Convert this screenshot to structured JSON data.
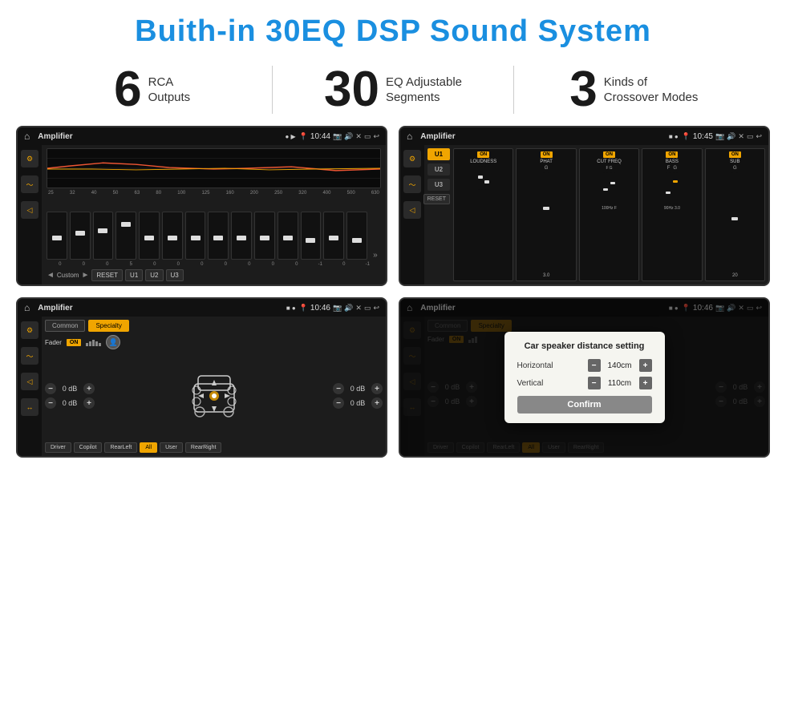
{
  "page": {
    "title": "Buith-in 30EQ DSP Sound System",
    "stats": [
      {
        "number": "6",
        "label": "RCA\nOutputs"
      },
      {
        "number": "30",
        "label": "EQ Adjustable\nSegments"
      },
      {
        "number": "3",
        "label": "Kinds of\nCrossover Modes"
      }
    ]
  },
  "screens": [
    {
      "id": "screen1",
      "time": "10:44",
      "title": "Amplifier",
      "type": "eq"
    },
    {
      "id": "screen2",
      "time": "10:45",
      "title": "Amplifier",
      "type": "amp"
    },
    {
      "id": "screen3",
      "time": "10:46",
      "title": "Amplifier",
      "type": "cs"
    },
    {
      "id": "screen4",
      "time": "10:46",
      "title": "Amplifier",
      "type": "cs-dialog"
    }
  ],
  "eq": {
    "frequencies": [
      "25",
      "32",
      "40",
      "50",
      "63",
      "80",
      "100",
      "125",
      "160",
      "200",
      "250",
      "320",
      "400",
      "500",
      "630"
    ],
    "values": [
      "0",
      "0",
      "0",
      "5",
      "0",
      "0",
      "0",
      "0",
      "0",
      "0",
      "0",
      "-1",
      "0",
      "-1"
    ],
    "buttons": [
      "Custom",
      "RESET",
      "U1",
      "U2",
      "U3"
    ],
    "presets": [
      "U1",
      "U2",
      "U3"
    ]
  },
  "amp": {
    "presets": [
      "U1",
      "U2",
      "U3"
    ],
    "channels": [
      "LOUDNESS",
      "PHAT",
      "CUT FREQ",
      "BASS",
      "SUB"
    ],
    "reset_label": "RESET"
  },
  "cs": {
    "tabs": [
      "Common",
      "Specialty"
    ],
    "fader_label": "Fader",
    "on_label": "ON",
    "db_values": [
      "0 dB",
      "0 dB",
      "0 dB",
      "0 dB"
    ],
    "bottom_btns": [
      "Driver",
      "Copilot",
      "RearLeft",
      "All",
      "User",
      "RearRight"
    ]
  },
  "dialog": {
    "title": "Car speaker distance setting",
    "horizontal_label": "Horizontal",
    "horizontal_value": "140cm",
    "vertical_label": "Vertical",
    "vertical_value": "110cm",
    "confirm_label": "Confirm"
  }
}
